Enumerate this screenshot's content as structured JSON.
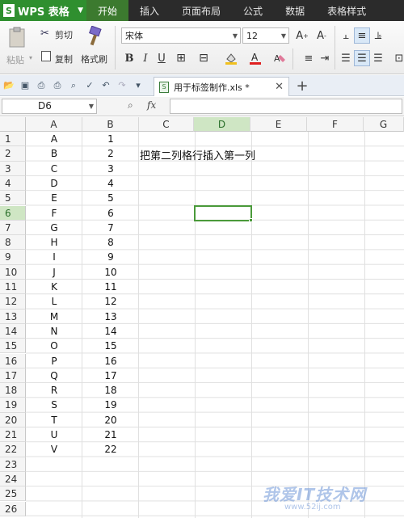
{
  "app": {
    "name": "WPS 表格",
    "logo_glyph": "S"
  },
  "menu": {
    "tabs": [
      "开始",
      "插入",
      "页面布局",
      "公式",
      "数据",
      "表格样式"
    ]
  },
  "ribbon": {
    "paste": "粘贴",
    "cut": "剪切",
    "copy": "复制",
    "format_painter": "格式刷",
    "font_name": "宋体",
    "font_size": "12"
  },
  "document": {
    "tab_name": "用于标签制作.xls *"
  },
  "formula_bar": {
    "cell_ref": "D6",
    "fx": "fx",
    "content": ""
  },
  "grid": {
    "columns": [
      "A",
      "B",
      "C",
      "D",
      "E",
      "F",
      "G"
    ],
    "rows": [
      "1",
      "2",
      "3",
      "4",
      "5",
      "6",
      "7",
      "8",
      "9",
      "10",
      "11",
      "12",
      "13",
      "14",
      "15",
      "16",
      "17",
      "18",
      "19",
      "20",
      "21",
      "22",
      "23",
      "24",
      "25",
      "26"
    ],
    "col_a": [
      "A",
      "B",
      "C",
      "D",
      "E",
      "F",
      "G",
      "H",
      "I",
      "J",
      "K",
      "L",
      "M",
      "N",
      "O",
      "P",
      "Q",
      "R",
      "S",
      "T",
      "U",
      "V"
    ],
    "col_b": [
      "1",
      "2",
      "3",
      "4",
      "5",
      "6",
      "7",
      "8",
      "9",
      "10",
      "11",
      "12",
      "13",
      "14",
      "15",
      "16",
      "17",
      "18",
      "19",
      "20",
      "21",
      "22"
    ],
    "note": "把第二列格行插入第一列",
    "selected_col": "D",
    "selected_row": "6"
  },
  "watermark": {
    "main": "我爱IT技术网",
    "sub": "www.52ij.com"
  },
  "colors": {
    "accent": "#2f8f2f",
    "selection": "#4a9a3a"
  }
}
